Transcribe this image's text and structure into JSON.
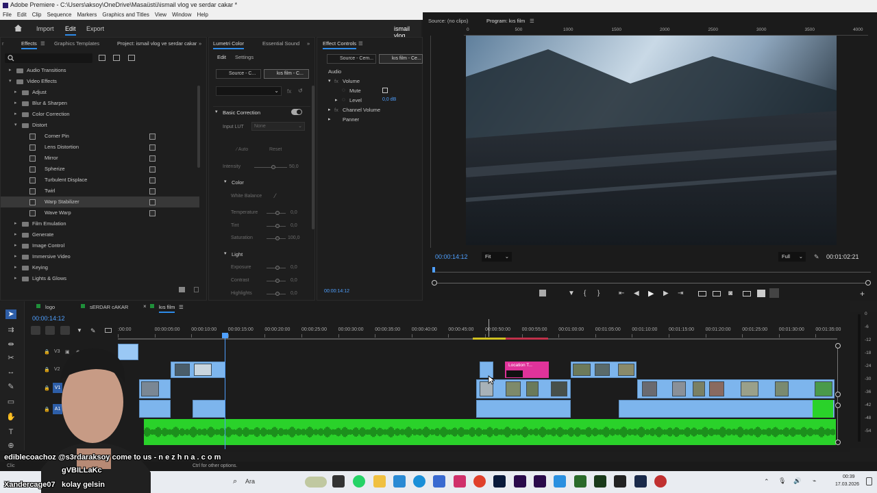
{
  "window": {
    "title": "Adobe Premiere - C:\\Users\\aksoy\\OneDrive\\Masaüstü\\ismail vlog ve serdar cakar *"
  },
  "menu": [
    "File",
    "Edit",
    "Clip",
    "Sequence",
    "Markers",
    "Graphics and Titles",
    "View",
    "Window",
    "Help"
  ],
  "workspace": {
    "home": "home",
    "import": "Import",
    "edit": "Edit",
    "export": "Export",
    "project": "ismail vlog"
  },
  "effects_panel": {
    "tabs": [
      "Effects",
      "Graphics Templates",
      "Project: ismail vlog ve serdar cakar"
    ],
    "tree": [
      {
        "label": "Audio Transitions",
        "level": 0,
        "open": false
      },
      {
        "label": "Video Effects",
        "level": 0,
        "open": true
      },
      {
        "label": "Adjust",
        "level": 1,
        "open": false
      },
      {
        "label": "Blur & Sharpen",
        "level": 1,
        "open": false
      },
      {
        "label": "Color Correction",
        "level": 1,
        "open": false
      },
      {
        "label": "Distort",
        "level": 1,
        "open": true
      },
      {
        "label": "Corner Pin",
        "level": 2,
        "effect": true
      },
      {
        "label": "Lens Distortion",
        "level": 2,
        "effect": true
      },
      {
        "label": "Mirror",
        "level": 2,
        "effect": true
      },
      {
        "label": "Spherize",
        "level": 2,
        "effect": true
      },
      {
        "label": "Turbulent Displace",
        "level": 2,
        "effect": true
      },
      {
        "label": "Twirl",
        "level": 2,
        "effect": true
      },
      {
        "label": "Warp Stabilizer",
        "level": 2,
        "effect": true,
        "selected": true
      },
      {
        "label": "Wave Warp",
        "level": 2,
        "effect": true
      },
      {
        "label": "Film Emulation",
        "level": 1,
        "open": false
      },
      {
        "label": "Generate",
        "level": 1,
        "open": false
      },
      {
        "label": "Image Control",
        "level": 1,
        "open": false
      },
      {
        "label": "Immersive Video",
        "level": 1,
        "open": false
      },
      {
        "label": "Keying",
        "level": 1,
        "open": false
      },
      {
        "label": "Lights & Glows",
        "level": 1,
        "open": false
      }
    ]
  },
  "lumetri": {
    "tabs": [
      "Lumetri Color",
      "Essential Sound"
    ],
    "subtabs": [
      "Edit",
      "Settings"
    ],
    "sources": [
      "Source - C...",
      "kıs film - C..."
    ],
    "section": "Basic Correction",
    "input_lut_label": "Input LUT",
    "input_lut_value": "None",
    "auto": "Auto",
    "reset": "Reset",
    "intensity_label": "Intensity",
    "intensity_value": "50,0",
    "color_section": "Color",
    "white_balance": "White Balance",
    "temperature": {
      "label": "Temperature",
      "value": "0,0"
    },
    "tint": {
      "label": "Tint",
      "value": "0,0"
    },
    "saturation": {
      "label": "Saturation",
      "value": "100,0"
    },
    "light_section": "Light",
    "exposure": {
      "label": "Exposure",
      "value": "0,0"
    },
    "contrast": {
      "label": "Contrast",
      "value": "0,0"
    },
    "highlights": {
      "label": "Highlights",
      "value": "0,0"
    }
  },
  "effect_controls": {
    "tab": "Effect Controls",
    "sources": [
      "Source - Cem...",
      "kıs film - Ce..."
    ],
    "audio_label": "Audio",
    "volume": "Volume",
    "mute": "Mute",
    "level_label": "Level",
    "level_value": "0,0 dB",
    "channel_volume": "Channel Volume",
    "panner": "Panner",
    "timecode": "00:00:14:12"
  },
  "monitor": {
    "source_tab": "Source: (no clips)",
    "program_tab": "Program: kıs film",
    "ruler": [
      "0",
      "500",
      "1000",
      "1500",
      "2000",
      "2500",
      "3000",
      "3500",
      "4000"
    ],
    "timecode": "00:00:14:12",
    "fit": "Fit",
    "quality": "Full",
    "duration": "00:01:02:21"
  },
  "timeline": {
    "tabs": [
      "logo",
      "sERDAR cAKAR",
      "kıs film"
    ],
    "timecode": "00:00:14:12",
    "ruler": [
      ":00:00",
      "00:00:05:00",
      "00:00:10:00",
      "00:00:15:00",
      "00:00:20:00",
      "00:00:25:00",
      "00:00:30:00",
      "00:00:35:00",
      "00:00:40:00",
      "00:00:45:00",
      "00:00:50:00",
      "00:00:55:00",
      "00:01:00:00",
      "00:01:05:00",
      "00:01:10:00",
      "00:01:15:00",
      "00:01:20:00",
      "00:01:25:00",
      "00:01:30:00",
      "00:01:35:00"
    ],
    "tracks": [
      "V3",
      "V2",
      "V1",
      "A1"
    ],
    "title_clip": "Location T...",
    "db_scale": [
      "0",
      "-6",
      "-12",
      "-18",
      "-24",
      "-30",
      "-36",
      "-42",
      "-48",
      "-54"
    ]
  },
  "status": {
    "hint": "Ctrl for other options.",
    "clip_prefix": "Clic"
  },
  "taskbar": {
    "search": "Ara",
    "time": "00:39",
    "date": "17.03.2026"
  },
  "overlay": {
    "line1": "ediblecoachoz @s3rdaraksoy come to us - n e z h n a . c o m",
    "line2": "gVBILLaKc",
    "line3_user": "Xandercage07",
    "line3_msg": "kolay gelsin"
  },
  "colors": {
    "accent": "#2d8ceb",
    "clip_blue": "#7db5ed",
    "title_pink": "#e0339a",
    "audio_green": "#2ad22a",
    "playhead": "#4fa0ff"
  }
}
